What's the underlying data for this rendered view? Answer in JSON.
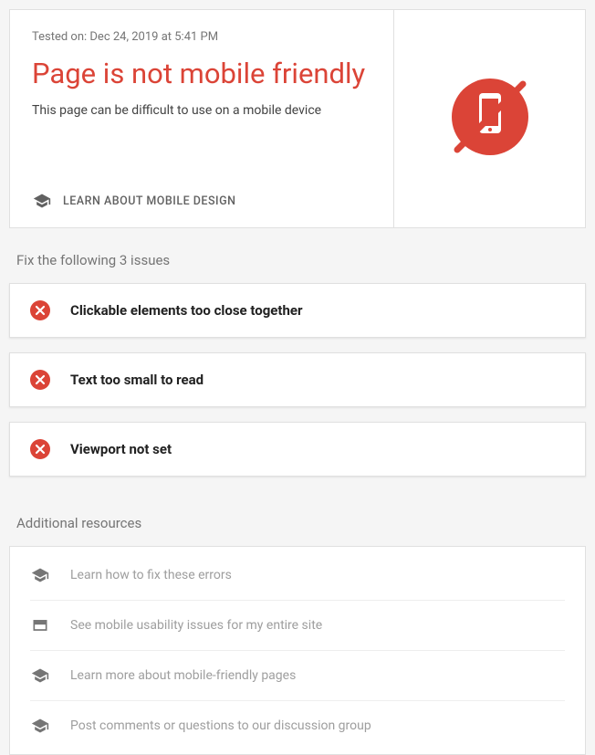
{
  "header": {
    "tested_on": "Tested on: Dec 24, 2019 at 5:41 PM",
    "title": "Page is not mobile friendly",
    "subtitle": "This page can be difficult to use on a mobile device",
    "learn_label": "LEARN ABOUT MOBILE DESIGN"
  },
  "issues": {
    "section_title": "Fix the following 3 issues",
    "items": [
      "Clickable elements too close together",
      "Text too small to read",
      "Viewport not set"
    ]
  },
  "resources": {
    "section_title": "Additional resources",
    "items": [
      {
        "icon": "graduation",
        "label": "Learn how to fix these errors"
      },
      {
        "icon": "web",
        "label": "See mobile usability issues for my entire site"
      },
      {
        "icon": "graduation",
        "label": "Learn more about mobile-friendly pages"
      },
      {
        "icon": "graduation",
        "label": "Post comments or questions to our discussion group"
      }
    ]
  },
  "colors": {
    "error": "#db4437",
    "muted": "#757575"
  }
}
